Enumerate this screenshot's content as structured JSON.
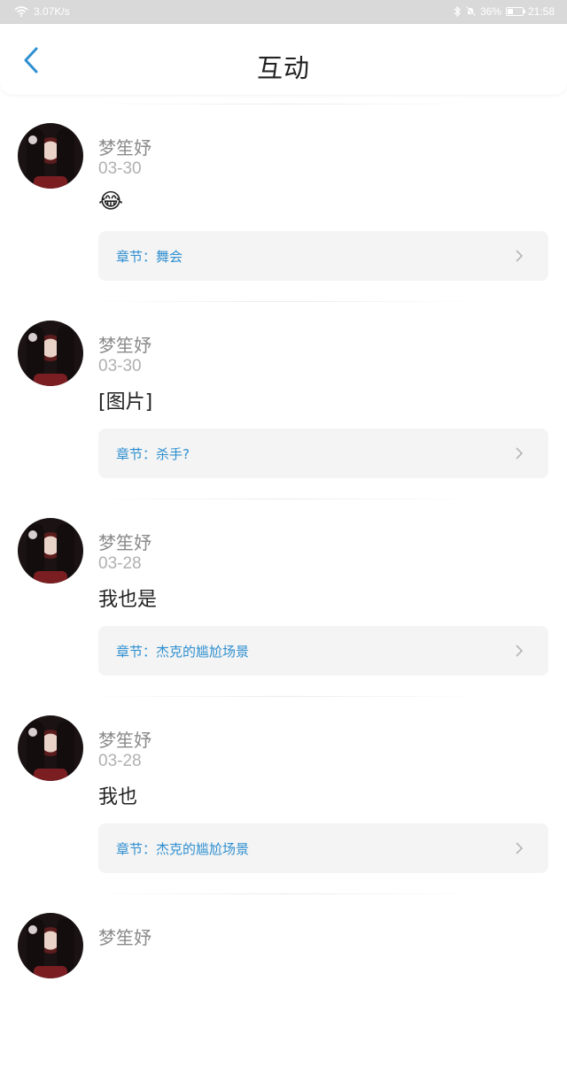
{
  "status_bar": {
    "speed": "3.07K/s",
    "battery": "36%",
    "time": "21:58"
  },
  "header": {
    "title": "互动"
  },
  "feed": [
    {
      "username": "梦笙妤",
      "date": "03-30",
      "content": "😂",
      "chapter": "章节：舞会"
    },
    {
      "username": "梦笙妤",
      "date": "03-30",
      "content": "[图片]",
      "chapter": "章节：杀手?"
    },
    {
      "username": "梦笙妤",
      "date": "03-28",
      "content": "我也是",
      "chapter": "章节：杰克的尴尬场景"
    },
    {
      "username": "梦笙妤",
      "date": "03-28",
      "content": "我也",
      "chapter": "章节：杰克的尴尬场景"
    },
    {
      "username": "梦笙妤"
    }
  ],
  "colors": {
    "accent": "#2f8fd0",
    "status_bar_bg": "#d9d9d9",
    "card_bg": "#f4f4f4"
  }
}
